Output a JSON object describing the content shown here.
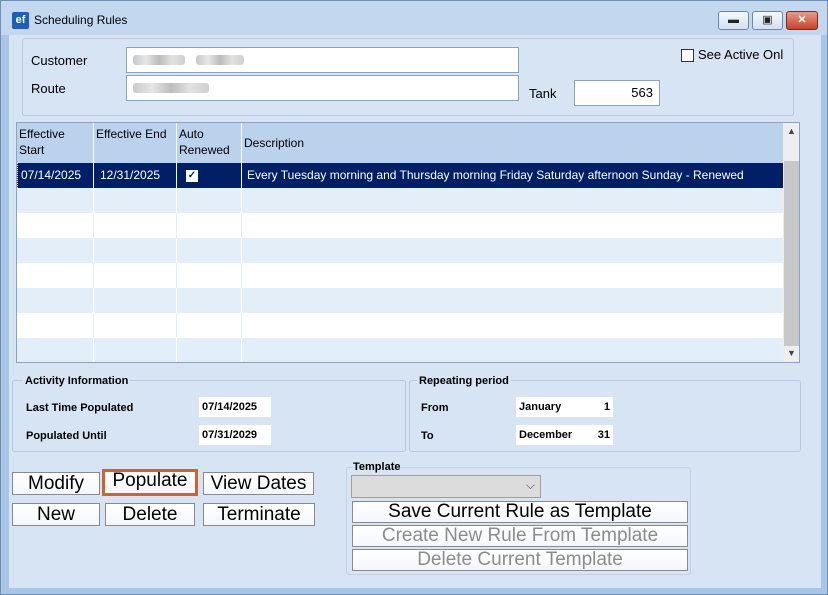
{
  "window": {
    "title": "Scheduling Rules",
    "app_icon": "ef"
  },
  "header": {
    "customer_label": "Customer",
    "route_label": "Route",
    "tank_label": "Tank",
    "tank_value": "563",
    "see_active_label": "See Active Onl",
    "see_active_checked": false
  },
  "grid": {
    "columns": [
      {
        "label": "Effective Start"
      },
      {
        "label": "Effective  End"
      },
      {
        "label": "Auto Renewed"
      },
      {
        "label": "Description"
      }
    ],
    "rows": [
      {
        "start": "07/14/2025",
        "end": "12/31/2025",
        "auto_renewed": "✓",
        "description": "Every Tuesday morning and Thursday morning Friday Saturday afternoon Sunday - Renewed"
      }
    ]
  },
  "activity": {
    "title": "Activity Information",
    "last_populated_label": "Last Time Populated",
    "last_populated_value": "07/14/2025",
    "populated_until_label": "Populated Until",
    "populated_until_value": "07/31/2029"
  },
  "repeating": {
    "title": "Repeating period",
    "from_label": "From",
    "from_month": "January",
    "from_day": "1",
    "to_label": "To",
    "to_month": "December",
    "to_day": "31"
  },
  "buttons": {
    "modify": "Modify",
    "populate": "Populate",
    "view_dates": "View Dates",
    "new": "New",
    "delete": "Delete",
    "terminate": "Terminate"
  },
  "template": {
    "label": "Template",
    "selected": "",
    "save": "Save Current Rule as Template",
    "create": "Create New Rule From Template",
    "delete": "Delete Current Template"
  },
  "colors": {
    "selected_row": "#001f66",
    "focus_border": "#d4602c",
    "header": "#bad2ec"
  }
}
